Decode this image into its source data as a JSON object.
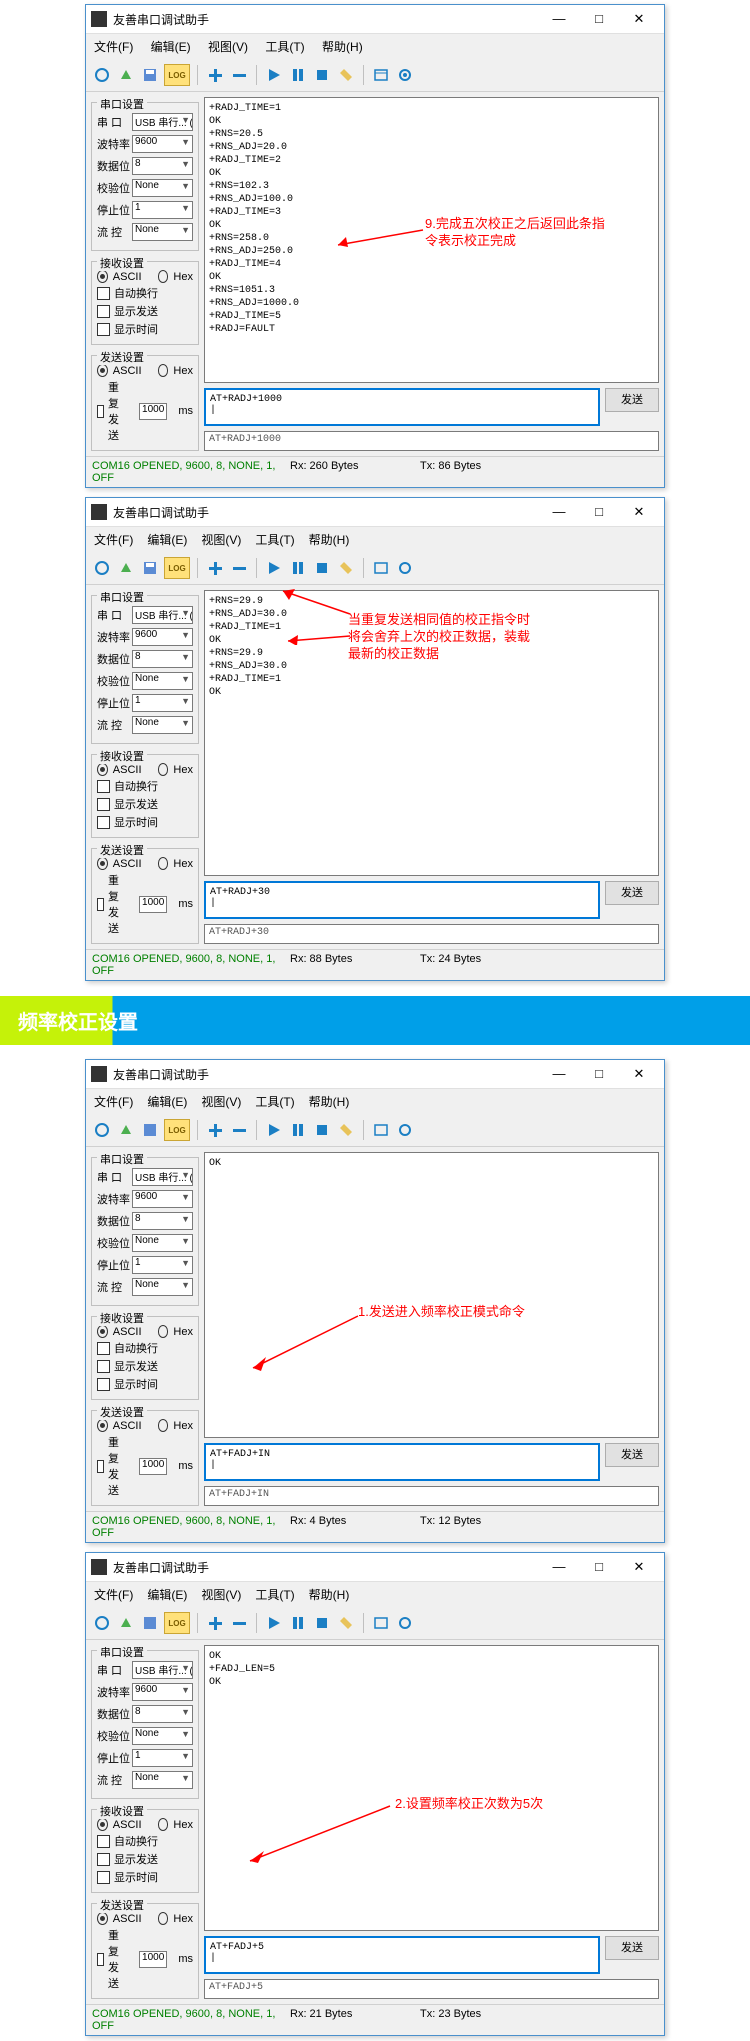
{
  "section_title": "频率校正设置",
  "win": {
    "title": "友善串口调试助手",
    "min": "—",
    "max": "□",
    "close": "✕",
    "menu": {
      "file": "文件(F)",
      "edit": "编辑(E)",
      "view": "视图(V)",
      "tool": "工具(T)",
      "help": "帮助(H)"
    },
    "grp": {
      "serial": "串口设置",
      "recv": "接收设置",
      "send": "发送设置"
    },
    "lbl": {
      "port": "串 口",
      "baud": "波特率",
      "data": "数据位",
      "parity": "校验位",
      "stop": "停止位",
      "flow": "流 控",
      "ascii": "ASCII",
      "hex": "Hex",
      "autowrap": "自动换行",
      "showsend": "显示发送",
      "showtime": "显示时间",
      "repeat": "重复发送",
      "ms": "ms"
    },
    "val": {
      "port_full": "USB 串行... (COM",
      "port_short": "USB 串行... (COM",
      "baud": "9600",
      "data": "8",
      "parity": "None",
      "stop": "1",
      "flow": "None",
      "repeat": "1000"
    },
    "send": "发送",
    "status_conn": "COM16 OPENED, 9600, 8, NONE, 1, OFF"
  },
  "s1": {
    "rx": "+RADJ_TIME=1\nOK\n+RNS=20.5\n+RNS_ADJ=20.0\n+RADJ_TIME=2\nOK\n+RNS=102.3\n+RNS_ADJ=100.0\n+RADJ_TIME=3\nOK\n+RNS=258.0\n+RNS_ADJ=250.0\n+RADJ_TIME=4\nOK\n+RNS=1051.3\n+RNS_ADJ=1000.0\n+RADJ_TIME=5\n+RADJ=FAULT",
    "tx": "AT+RADJ+1000",
    "echo": "AT+RADJ+1000",
    "rxb": "Rx: 260 Bytes",
    "txb": "Tx: 86 Bytes",
    "anno": "9.完成五次校正之后返回此条指\n令表示校正完成"
  },
  "s2": {
    "rx": "+RNS=29.9\n+RNS_ADJ=30.0\n+RADJ_TIME=1\nOK\n+RNS=29.9\n+RNS_ADJ=30.0\n+RADJ_TIME=1\nOK",
    "tx": "AT+RADJ+30",
    "echo": "AT+RADJ+30",
    "rxb": "Rx: 88 Bytes",
    "txb": "Tx: 24 Bytes",
    "anno": "当重复发送相同值的校正指令时\n将会舍弃上次的校正数据，装载\n最新的校正数据"
  },
  "s3": {
    "rx": "OK",
    "tx": "AT+FADJ+IN",
    "echo": "AT+FADJ+IN",
    "rxb": "Rx: 4 Bytes",
    "txb": "Tx: 12 Bytes",
    "anno": "1.发送进入频率校正模式命令"
  },
  "s4": {
    "rx": "OK\n+FADJ_LEN=5\nOK",
    "tx": "AT+FADJ+5",
    "echo": "AT+FADJ+5",
    "rxb": "Rx: 21 Bytes",
    "txb": "Tx: 23 Bytes",
    "anno": "2.设置频率校正次数为5次"
  }
}
